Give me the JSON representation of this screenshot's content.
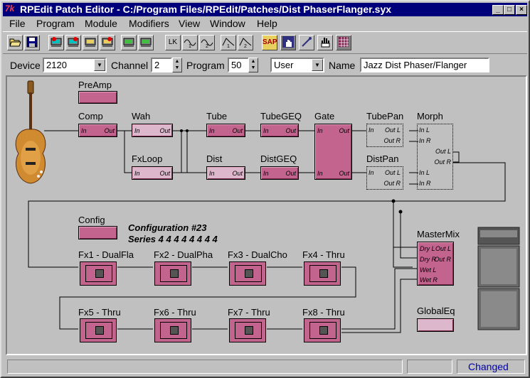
{
  "window": {
    "title": "RPEdit Patch Editor - C:/Program Files/RPEdit/Patches/Dist PhaserFlanger.syx",
    "app_icon_text": "7k",
    "controls": [
      "_",
      "□",
      "×"
    ]
  },
  "menu": [
    "File",
    "Program",
    "Module",
    "Modifiers",
    "View",
    "Window",
    "Help"
  ],
  "toolbar_icons": [
    "open-icon",
    "save-icon",
    "receive-patch-icon",
    "send-patch-icon",
    "receive-bank-icon",
    "send-bank-icon",
    "receive-all-icon",
    "send-all-icon",
    "lfo-k-icon",
    "lfo1-icon",
    "lfo2-icon",
    "envelope1-icon",
    "envelope2-icon",
    "sap-icon",
    "hand-grid-icon",
    "cable-icon",
    "hand-icon",
    "grid-icon"
  ],
  "toolbar_labels": {
    "sap": "SAP",
    "lk": "LK",
    "lfo1": "1",
    "lfo2": "2",
    "env1": "1",
    "env2": "2"
  },
  "params": {
    "device_label": "Device",
    "device_value": "2120",
    "channel_label": "Channel",
    "channel_value": "2",
    "program_label": "Program",
    "program_value": "50",
    "bank_value": "User",
    "name_label": "Name",
    "name_value": "Jazz Dist Phaser/Flanger"
  },
  "modules": {
    "preamp": "PreAmp",
    "comp": "Comp",
    "wah": "Wah",
    "fxloop": "FxLoop",
    "tube": "Tube",
    "tubegeq": "TubeGEQ",
    "dist": "Dist",
    "distgeq": "DistGEQ",
    "gate": "Gate",
    "tubepan": "TubePan",
    "distpan": "DistPan",
    "morph": "Morph",
    "config": "Config",
    "mastermix": "MasterMix",
    "globaleq": "GlobalEq"
  },
  "ports": {
    "in": "In",
    "out": "Out",
    "out_l": "Out L",
    "out_r": "Out R",
    "in_l": "In L",
    "in_r": "In R",
    "dry_l": "Dry L",
    "dry_r": "Dry R",
    "wet_l": "Wet L",
    "wet_r": "Wet R",
    "out_l2": "Out L",
    "out_r2": "Out R"
  },
  "configuration": {
    "title": "Configuration #23",
    "series": "Series 4 4 4 4 4 4 4 4"
  },
  "fx": [
    {
      "label": "Fx1 - DualFla"
    },
    {
      "label": "Fx2 - DualPha"
    },
    {
      "label": "Fx3 - DualCho"
    },
    {
      "label": "Fx4 - Thru"
    },
    {
      "label": "Fx5 - Thru"
    },
    {
      "label": "Fx6 - Thru"
    },
    {
      "label": "Fx7 - Thru"
    },
    {
      "label": "Fx8 - Thru"
    }
  ],
  "status": {
    "changed": "Changed"
  },
  "colors": {
    "module": "#c2648d",
    "module_light": "#ddb8cc",
    "titlebar": "#00007b",
    "face": "#c0c0c0",
    "status_text": "#0000b0"
  }
}
